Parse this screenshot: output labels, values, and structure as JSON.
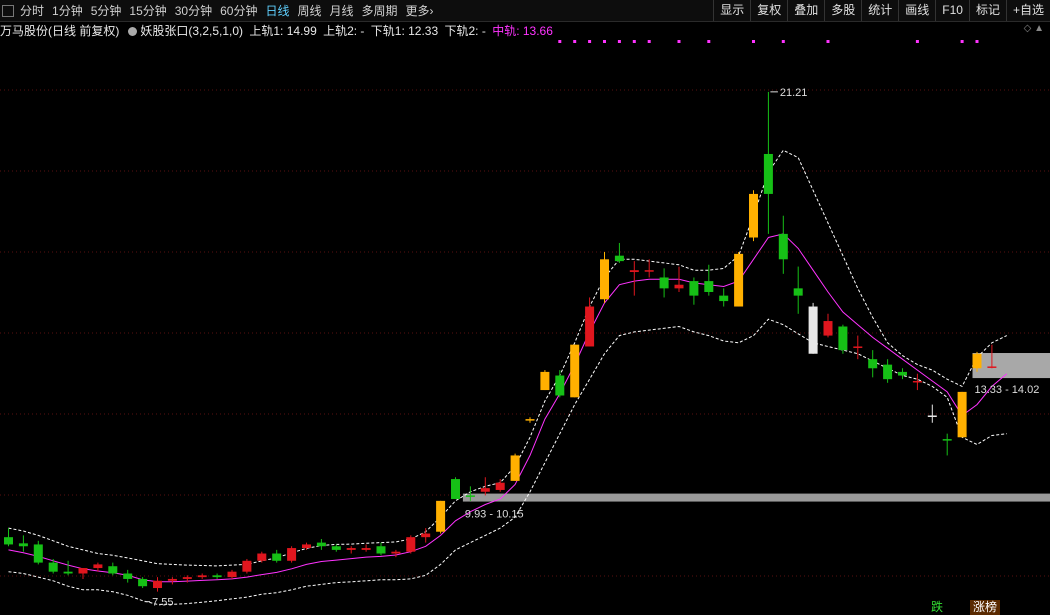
{
  "toolbar": {
    "periods": [
      "分时",
      "1分钟",
      "5分钟",
      "15分钟",
      "30分钟",
      "60分钟",
      "日线",
      "周线",
      "月线",
      "多周期",
      "更多"
    ],
    "active_period": "日线",
    "more_arrow": "›",
    "right_buttons": [
      "显示",
      "复权",
      "叠加",
      "多股",
      "统计",
      "画线",
      "F10",
      "标记",
      "+自选"
    ]
  },
  "info": {
    "stock_name": "万马股份(日线 前复权)",
    "indicator": "妖股张口(3,2,5,1,0)",
    "upper1": "上轨1: 14.99",
    "upper2": "上轨2: -",
    "lower1": "下轨1: 12.33",
    "lower2": "下轨2: -",
    "middle": "中轨: 13.66"
  },
  "annotations": {
    "high": "21.21",
    "low": "7.55",
    "zone_high": "13.33 - 14.02",
    "zone_low": "9.93 - 10.15"
  },
  "badges": {
    "drop": "跌",
    "limit_up": "涨榜"
  },
  "colors": {
    "up_limit": "#ffb000",
    "up": "#e0161e",
    "down": "#16c016",
    "pink": "#ff33ff"
  },
  "chart_data": {
    "type": "candlestick",
    "price_range": [
      7.0,
      22.5
    ],
    "candles": [
      {
        "o": 8.95,
        "h": 9.2,
        "l": 8.7,
        "c": 8.75,
        "k": "down"
      },
      {
        "o": 8.78,
        "h": 9.0,
        "l": 8.55,
        "c": 8.7,
        "k": "down"
      },
      {
        "o": 8.75,
        "h": 8.85,
        "l": 8.2,
        "c": 8.25,
        "k": "down"
      },
      {
        "o": 8.25,
        "h": 8.35,
        "l": 7.95,
        "c": 8.0,
        "k": "down"
      },
      {
        "o": 8.0,
        "h": 8.3,
        "l": 7.9,
        "c": 7.95,
        "k": "down"
      },
      {
        "o": 7.95,
        "h": 8.1,
        "l": 7.8,
        "c": 8.1,
        "k": "up"
      },
      {
        "o": 8.1,
        "h": 8.25,
        "l": 8.0,
        "c": 8.2,
        "k": "up"
      },
      {
        "o": 8.15,
        "h": 8.25,
        "l": 7.9,
        "c": 7.95,
        "k": "down"
      },
      {
        "o": 7.95,
        "h": 8.05,
        "l": 7.7,
        "c": 7.8,
        "k": "down"
      },
      {
        "o": 7.8,
        "h": 7.85,
        "l": 7.55,
        "c": 7.6,
        "k": "down"
      },
      {
        "o": 7.55,
        "h": 7.85,
        "l": 7.45,
        "c": 7.75,
        "k": "up"
      },
      {
        "o": 7.75,
        "h": 7.85,
        "l": 7.65,
        "c": 7.8,
        "k": "up"
      },
      {
        "o": 7.8,
        "h": 7.9,
        "l": 7.7,
        "c": 7.85,
        "k": "up"
      },
      {
        "o": 7.85,
        "h": 7.95,
        "l": 7.8,
        "c": 7.9,
        "k": "up"
      },
      {
        "o": 7.9,
        "h": 7.95,
        "l": 7.8,
        "c": 7.85,
        "k": "down"
      },
      {
        "o": 7.85,
        "h": 8.05,
        "l": 7.8,
        "c": 8.0,
        "k": "up"
      },
      {
        "o": 8.0,
        "h": 8.35,
        "l": 7.95,
        "c": 8.3,
        "k": "up"
      },
      {
        "o": 8.3,
        "h": 8.55,
        "l": 8.25,
        "c": 8.5,
        "k": "up"
      },
      {
        "o": 8.5,
        "h": 8.6,
        "l": 8.25,
        "c": 8.3,
        "k": "down"
      },
      {
        "o": 8.3,
        "h": 8.7,
        "l": 8.25,
        "c": 8.65,
        "k": "up"
      },
      {
        "o": 8.65,
        "h": 8.8,
        "l": 8.6,
        "c": 8.75,
        "k": "up"
      },
      {
        "o": 8.8,
        "h": 8.9,
        "l": 8.6,
        "c": 8.7,
        "k": "down"
      },
      {
        "o": 8.7,
        "h": 8.75,
        "l": 8.55,
        "c": 8.6,
        "k": "down"
      },
      {
        "o": 8.6,
        "h": 8.7,
        "l": 8.5,
        "c": 8.65,
        "k": "up"
      },
      {
        "o": 8.65,
        "h": 8.75,
        "l": 8.55,
        "c": 8.6,
        "k": "up"
      },
      {
        "o": 8.7,
        "h": 8.8,
        "l": 8.45,
        "c": 8.5,
        "k": "down"
      },
      {
        "o": 8.5,
        "h": 8.6,
        "l": 8.4,
        "c": 8.55,
        "k": "up"
      },
      {
        "o": 8.55,
        "h": 9.0,
        "l": 8.5,
        "c": 8.95,
        "k": "up"
      },
      {
        "o": 8.95,
        "h": 9.2,
        "l": 8.8,
        "c": 9.05,
        "k": "up"
      },
      {
        "o": 9.1,
        "h": 9.95,
        "l": 9.05,
        "c": 9.95,
        "k": "limit_up"
      },
      {
        "o": 10.0,
        "h": 10.6,
        "l": 10.0,
        "c": 10.55,
        "k": "down"
      },
      {
        "o": 10.1,
        "h": 10.35,
        "l": 9.95,
        "c": 10.1,
        "k": "down"
      },
      {
        "o": 10.2,
        "h": 10.6,
        "l": 10.1,
        "c": 10.3,
        "k": "up"
      },
      {
        "o": 10.25,
        "h": 10.55,
        "l": 10.2,
        "c": 10.45,
        "k": "up"
      },
      {
        "o": 10.5,
        "h": 11.25,
        "l": 10.5,
        "c": 11.2,
        "k": "limit_up"
      },
      {
        "o": 12.2,
        "h": 12.25,
        "l": 12.1,
        "c": 12.2,
        "k": "limit_up"
      },
      {
        "o": 13.0,
        "h": 13.55,
        "l": 13.0,
        "c": 13.5,
        "k": "limit_up"
      },
      {
        "o": 13.4,
        "h": 13.55,
        "l": 12.8,
        "c": 12.85,
        "k": "down"
      },
      {
        "o": 12.8,
        "h": 14.25,
        "l": 12.8,
        "c": 14.25,
        "k": "limit_up"
      },
      {
        "o": 14.2,
        "h": 15.55,
        "l": 14.2,
        "c": 15.3,
        "k": "up"
      },
      {
        "o": 15.5,
        "h": 16.8,
        "l": 15.4,
        "c": 16.6,
        "k": "limit_up"
      },
      {
        "o": 16.7,
        "h": 17.05,
        "l": 16.5,
        "c": 16.55,
        "k": "down"
      },
      {
        "o": 16.3,
        "h": 16.55,
        "l": 15.6,
        "c": 16.25,
        "k": "up"
      },
      {
        "o": 16.3,
        "h": 16.6,
        "l": 16.1,
        "c": 16.3,
        "k": "up"
      },
      {
        "o": 16.1,
        "h": 16.35,
        "l": 15.55,
        "c": 15.8,
        "k": "down"
      },
      {
        "o": 15.9,
        "h": 16.4,
        "l": 15.7,
        "c": 15.8,
        "k": "up"
      },
      {
        "o": 15.6,
        "h": 16.1,
        "l": 15.35,
        "c": 16.0,
        "k": "down"
      },
      {
        "o": 16.0,
        "h": 16.45,
        "l": 15.6,
        "c": 15.7,
        "k": "down"
      },
      {
        "o": 15.6,
        "h": 15.8,
        "l": 15.3,
        "c": 15.45,
        "k": "down"
      },
      {
        "o": 15.3,
        "h": 16.8,
        "l": 15.3,
        "c": 16.75,
        "k": "limit_up"
      },
      {
        "o": 17.2,
        "h": 18.5,
        "l": 17.1,
        "c": 18.4,
        "k": "limit_up"
      },
      {
        "o": 18.4,
        "h": 21.21,
        "l": 17.3,
        "c": 19.5,
        "k": "down"
      },
      {
        "o": 17.3,
        "h": 17.8,
        "l": 16.2,
        "c": 16.6,
        "k": "down"
      },
      {
        "o": 15.8,
        "h": 16.4,
        "l": 15.1,
        "c": 15.6,
        "k": "down"
      },
      {
        "o": 15.3,
        "h": 15.4,
        "l": 14.0,
        "c": 14.0,
        "k": "neutral"
      },
      {
        "o": 14.9,
        "h": 15.1,
        "l": 14.45,
        "c": 14.5,
        "k": "up"
      },
      {
        "o": 14.1,
        "h": 14.8,
        "l": 14.0,
        "c": 14.75,
        "k": "down"
      },
      {
        "o": 14.2,
        "h": 14.5,
        "l": 13.85,
        "c": 14.2,
        "k": "up"
      },
      {
        "o": 13.85,
        "h": 14.1,
        "l": 13.35,
        "c": 13.6,
        "k": "down"
      },
      {
        "o": 13.7,
        "h": 13.85,
        "l": 13.2,
        "c": 13.3,
        "k": "down"
      },
      {
        "o": 13.5,
        "h": 13.6,
        "l": 13.3,
        "c": 13.4,
        "k": "down"
      },
      {
        "o": 13.25,
        "h": 13.45,
        "l": 13.0,
        "c": 13.25,
        "k": "up"
      },
      {
        "o": 12.3,
        "h": 12.6,
        "l": 12.1,
        "c": 12.3,
        "k": "neutral"
      },
      {
        "o": 11.65,
        "h": 11.8,
        "l": 11.2,
        "c": 11.65,
        "k": "down"
      },
      {
        "o": 11.7,
        "h": 12.95,
        "l": 11.7,
        "c": 12.95,
        "k": "limit_up"
      },
      {
        "o": 13.6,
        "h": 14.05,
        "l": 13.5,
        "c": 14.0,
        "k": "limit_up"
      },
      {
        "o": 13.65,
        "h": 14.25,
        "l": 13.6,
        "c": 13.65,
        "k": "up"
      }
    ],
    "upper_band": [
      9.2,
      9.12,
      9.0,
      8.85,
      8.7,
      8.6,
      8.5,
      8.45,
      8.38,
      8.3,
      8.22,
      8.2,
      8.18,
      8.17,
      8.16,
      8.18,
      8.2,
      8.3,
      8.38,
      8.52,
      8.64,
      8.72,
      8.75,
      8.76,
      8.78,
      8.8,
      8.82,
      8.9,
      9.1,
      9.5,
      9.95,
      10.2,
      10.35,
      10.45,
      10.9,
      11.7,
      12.7,
      13.4,
      14.3,
      15.3,
      16.1,
      16.6,
      16.6,
      16.55,
      16.5,
      16.45,
      16.3,
      16.3,
      16.35,
      16.7,
      17.8,
      19.0,
      19.6,
      19.4,
      18.5,
      17.6,
      16.7,
      15.8,
      15.0,
      14.3,
      13.95,
      13.7,
      13.55,
      13.3,
      13.1,
      13.9,
      14.3,
      14.5
    ],
    "lower_band": [
      8.0,
      7.95,
      7.85,
      7.75,
      7.6,
      7.5,
      7.5,
      7.45,
      7.35,
      7.2,
      7.1,
      7.1,
      7.12,
      7.16,
      7.2,
      7.25,
      7.3,
      7.38,
      7.42,
      7.5,
      7.6,
      7.65,
      7.7,
      7.72,
      7.75,
      7.78,
      7.78,
      7.8,
      7.9,
      8.2,
      8.6,
      8.8,
      9.0,
      9.2,
      9.5,
      10.2,
      11.0,
      11.8,
      12.6,
      13.3,
      14.0,
      14.5,
      14.6,
      14.65,
      14.7,
      14.75,
      14.6,
      14.5,
      14.35,
      14.3,
      14.5,
      14.95,
      14.8,
      14.55,
      14.3,
      14.2,
      14.1,
      14.0,
      13.8,
      13.6,
      13.4,
      13.3,
      13.1,
      12.8,
      11.7,
      11.5,
      11.75,
      11.8
    ],
    "middle_line": [
      8.6,
      8.52,
      8.42,
      8.3,
      8.18,
      8.08,
      8.02,
      7.97,
      7.9,
      7.78,
      7.72,
      7.72,
      7.74,
      7.76,
      7.78,
      7.8,
      7.85,
      7.92,
      7.98,
      8.08,
      8.2,
      8.28,
      8.32,
      8.36,
      8.4,
      8.42,
      8.46,
      8.55,
      8.7,
      9.0,
      9.4,
      9.65,
      9.85,
      10.0,
      10.4,
      11.2,
      12.2,
      12.9,
      13.7,
      14.6,
      15.4,
      15.9,
      16.0,
      16.05,
      16.05,
      16.05,
      15.95,
      15.9,
      15.85,
      16.0,
      16.6,
      17.2,
      17.3,
      16.9,
      16.3,
      15.7,
      15.15,
      14.8,
      14.45,
      14.15,
      13.85,
      13.55,
      13.25,
      12.95,
      12.3,
      12.6,
      13.1,
      13.45
    ]
  }
}
